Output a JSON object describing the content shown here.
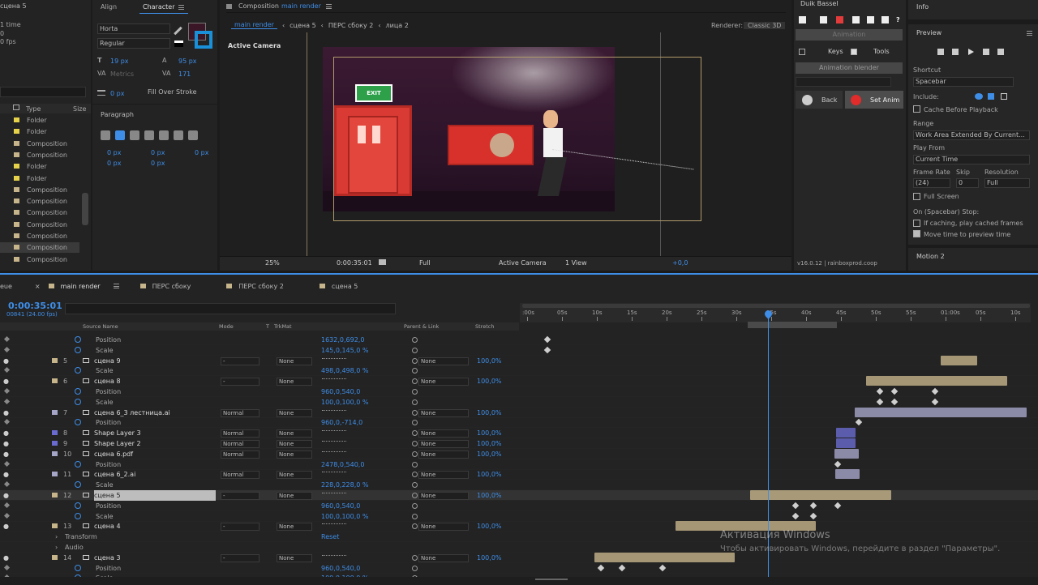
{
  "project": {
    "title": "сцена 5",
    "info1": "1 time",
    "info2": "0",
    "info3": "0 fps",
    "type_header": "Type",
    "size_header": "Size",
    "items": [
      {
        "type": "Folder",
        "color": "#e6d24a"
      },
      {
        "type": "Folder",
        "color": "#e6d24a"
      },
      {
        "type": "Composition",
        "color": "#c6b48a"
      },
      {
        "type": "Composition",
        "color": "#c6b48a"
      },
      {
        "type": "Folder",
        "color": "#e6d24a"
      },
      {
        "type": "Folder",
        "color": "#e6d24a"
      },
      {
        "type": "Composition",
        "color": "#c6b48a"
      },
      {
        "type": "Composition",
        "color": "#c6b48a"
      },
      {
        "type": "Composition",
        "color": "#c6b48a"
      },
      {
        "type": "Composition",
        "color": "#c6b48a"
      },
      {
        "type": "Composition",
        "color": "#c6b48a"
      },
      {
        "type": "Composition",
        "color": "#c6b48a"
      },
      {
        "type": "Composition",
        "color": "#c6b48a"
      }
    ]
  },
  "character": {
    "tab_align": "Align",
    "tab_character": "Character",
    "font": "Horta",
    "style": "Regular",
    "size": "19 px",
    "leading": "95 px",
    "kerning": "Metrics",
    "tracking": "171",
    "stroke": "0 px",
    "stroke_mode": "Fill Over Stroke",
    "fill_color": "#3a1626"
  },
  "paragraph": {
    "title": "Paragraph",
    "indent1": "0 px",
    "indent2": "0 px",
    "indent3": "0 px",
    "space1": "0 px",
    "space2": "0 px"
  },
  "composition": {
    "tab": "Composition",
    "name": "main render",
    "crumbs": [
      "main render",
      "сцена 5",
      "ПЕРС сбоку 2",
      "лица 2"
    ],
    "renderer_label": "Renderer:",
    "renderer": "Classic 3D",
    "active_camera": "Active Camera",
    "zoom": "25%",
    "timecode": "0:00:35:01",
    "quality": "Full",
    "camera": "Active Camera",
    "view": "1 View",
    "offset": "+0,0",
    "exit_sign": "EXIT"
  },
  "duik": {
    "title": "Duik Bassel",
    "animation": "Animation",
    "keys": "Keys",
    "tools": "Tools",
    "blender": "Animation blender",
    "back": "Back",
    "set_anim": "Set Anim",
    "version": "v16.0.12 | rainboxprod.coop"
  },
  "info": {
    "title": "Info",
    "preview": "Preview",
    "shortcut_label": "Shortcut",
    "shortcut": "Spacebar",
    "include_label": "Include:",
    "cache": "Cache Before Playback",
    "range_label": "Range",
    "range": "Work Area Extended By Current...",
    "playfrom_label": "Play From",
    "playfrom": "Current Time",
    "framerate_label": "Frame Rate",
    "skip_label": "Skip",
    "resolution_label": "Resolution",
    "framerate": "(24)",
    "skip": "0",
    "resolution": "Full",
    "fullscreen": "Full Screen",
    "stop_label": "On (Spacebar) Stop:",
    "opt1": "If caching, play cached frames",
    "opt2": "Move time to preview time",
    "motion": "Motion 2"
  },
  "timeline": {
    "tabs": [
      "eue",
      "main render",
      "ПЕРС сбоку",
      "ПЕРС сбоку 2",
      "сцена 5"
    ],
    "timecode": "0:00:35:01",
    "fps": "00841 (24.00 fps)",
    "col_source": "Source Name",
    "col_mode": "Mode",
    "col_t": "T",
    "col_trkmat": "TrkMat",
    "col_parent": "Parent & Link",
    "col_stretch": "Stretch",
    "ruler": [
      ":00s",
      "05s",
      "10s",
      "15s",
      "20s",
      "25s",
      "30s",
      "35s",
      "40s",
      "45s",
      "50s",
      "55s",
      "01:00s",
      "05s",
      "10s"
    ],
    "rows": [
      {
        "kind": "prop",
        "name": "Position",
        "value": "1632,0,692,0"
      },
      {
        "kind": "prop",
        "name": "Scale",
        "value": "145,0,145,0 %"
      },
      {
        "kind": "layer",
        "num": "5",
        "name": "сцена 9",
        "mode": "-",
        "trk": "None",
        "parent": "None",
        "stretch": "100,0%",
        "color": "#c6b48a"
      },
      {
        "kind": "prop",
        "name": "Scale",
        "value": "498,0,498,0 %"
      },
      {
        "kind": "layer",
        "num": "6",
        "name": "сцена 8",
        "mode": "-",
        "trk": "None",
        "parent": "None",
        "stretch": "100,0%",
        "color": "#c6b48a"
      },
      {
        "kind": "prop",
        "name": "Position",
        "value": "960,0,540,0"
      },
      {
        "kind": "prop",
        "name": "Scale",
        "value": "100,0,100,0 %"
      },
      {
        "kind": "layer",
        "num": "7",
        "name": "сцена 6_3 лестница.ai",
        "mode": "Normal",
        "trk": "None",
        "parent": "None",
        "stretch": "100,0%",
        "color": "#a5a5c8"
      },
      {
        "kind": "prop",
        "name": "Position",
        "value": "960,0,-714,0"
      },
      {
        "kind": "layer",
        "num": "8",
        "name": "Shape Layer 3",
        "mode": "Normal",
        "trk": "None",
        "parent": "None",
        "stretch": "100,0%",
        "color": "#6a6ad0"
      },
      {
        "kind": "layer",
        "num": "9",
        "name": "Shape Layer 2",
        "mode": "Normal",
        "trk": "None",
        "parent": "None",
        "stretch": "100,0%",
        "color": "#6a6ad0"
      },
      {
        "kind": "layer",
        "num": "10",
        "name": "сцена 6.pdf",
        "mode": "Normal",
        "trk": "None",
        "parent": "None",
        "stretch": "100,0%",
        "color": "#a5a5c8"
      },
      {
        "kind": "prop",
        "name": "Position",
        "value": "2478,0,540,0"
      },
      {
        "kind": "layer",
        "num": "11",
        "name": "сцена 6_2.ai",
        "mode": "Normal",
        "trk": "None",
        "parent": "None",
        "stretch": "100,0%",
        "color": "#a5a5c8"
      },
      {
        "kind": "prop",
        "name": "Scale",
        "value": "228,0,228,0 %"
      },
      {
        "kind": "layer",
        "num": "12",
        "name": "сцена 5",
        "mode": "-",
        "trk": "None",
        "parent": "None",
        "stretch": "100,0%",
        "color": "#c6b48a",
        "selected": true
      },
      {
        "kind": "prop",
        "name": "Position",
        "value": "960,0,540,0"
      },
      {
        "kind": "prop",
        "name": "Scale",
        "value": "100,0,100,0 %"
      },
      {
        "kind": "layer",
        "num": "13",
        "name": "сцена 4",
        "mode": "-",
        "trk": "None",
        "parent": "None",
        "stretch": "100,0%",
        "color": "#c6b48a"
      },
      {
        "kind": "group",
        "name": "Transform",
        "value": "Reset"
      },
      {
        "kind": "group",
        "name": "Audio",
        "value": ""
      },
      {
        "kind": "layer",
        "num": "14",
        "name": "сцена 3",
        "mode": "-",
        "trk": "None",
        "parent": "None",
        "stretch": "100,0%",
        "color": "#c6b48a"
      },
      {
        "kind": "prop",
        "name": "Position",
        "value": "960,0,540,0"
      },
      {
        "kind": "prop",
        "name": "Scale",
        "value": "100,0,100,0 %"
      }
    ]
  },
  "watermark": {
    "line1": "Активация Windows",
    "line2": "Чтобы активировать Windows, перейдите в раздел \"Параметры\"."
  }
}
